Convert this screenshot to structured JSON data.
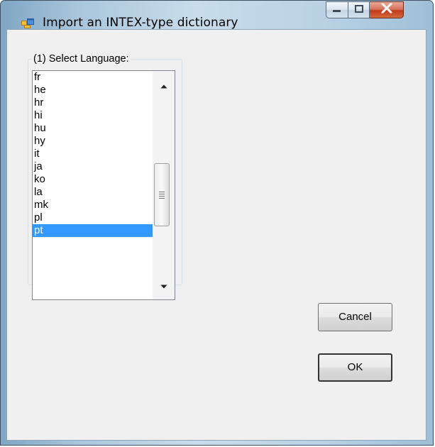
{
  "window": {
    "title": "Import an INTEX-type dictionary",
    "icon": "app-window-icon"
  },
  "caption_buttons": {
    "minimize": "minimize-icon",
    "maximize": "maximize-icon",
    "close": "close-icon"
  },
  "group": {
    "label": "(1) Select Language:"
  },
  "language_list": {
    "items": [
      "fr",
      "he",
      "hr",
      "hi",
      "hu",
      "hy",
      "it",
      "ja",
      "ko",
      "la",
      "mk",
      "pl",
      "pt"
    ],
    "selected": "pt"
  },
  "buttons": {
    "cancel": "Cancel",
    "ok": "OK"
  },
  "colors": {
    "selection": "#3399ff",
    "close_button": "#c2391a"
  }
}
